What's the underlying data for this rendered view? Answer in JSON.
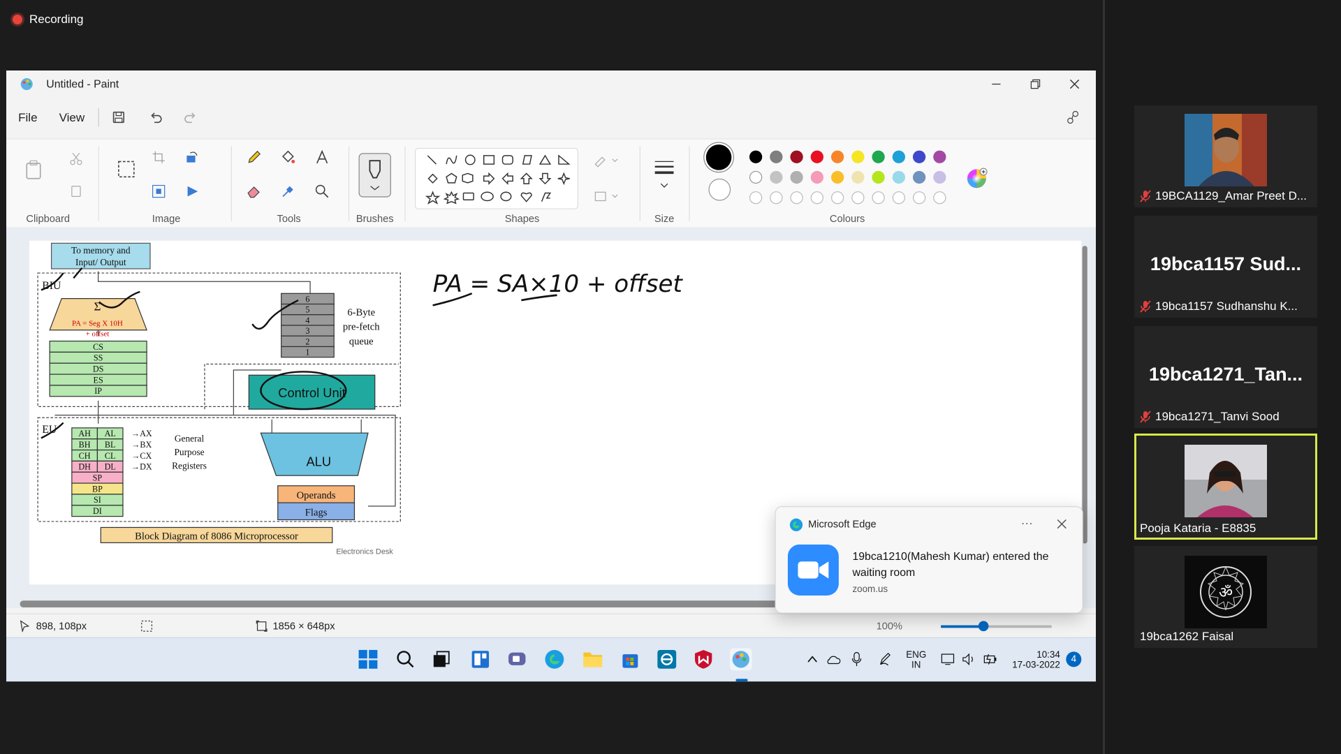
{
  "recording": {
    "label": "Recording"
  },
  "paint": {
    "title": "Untitled - Paint",
    "menu": {
      "file": "File",
      "view": "View"
    },
    "groups": {
      "clipboard": "Clipboard",
      "image": "Image",
      "tools": "Tools",
      "brushes": "Brushes",
      "shapes": "Shapes",
      "size": "Size",
      "colours": "Colours"
    },
    "palette_row1": [
      "#000000",
      "#7f7f7f",
      "#a01020",
      "#e81123",
      "#f7852a",
      "#f5e524",
      "#1fa84f",
      "#1ea0d8",
      "#3f48cc",
      "#a349a4"
    ],
    "palette_row2": [
      "#ffffff",
      "#c3c3c3",
      "#b0b0b0",
      "#f59bb7",
      "#f9be2a",
      "#efe4b0",
      "#b5e61d",
      "#99d9ea",
      "#7092be",
      "#c8bfe7"
    ],
    "status": {
      "cursor_pos": "898, 108px",
      "canvas_size": "1856 × 648px",
      "zoom": "100%"
    },
    "diagram": {
      "memory_box": "To memory and\nInput/ Output",
      "biu": "BIU",
      "eu": "EU",
      "sigma": "Σ",
      "pa_formula_1": "PA = Seg X 10H",
      "pa_formula_2": "+ offset",
      "segment_regs": [
        "CS",
        "SS",
        "DS",
        "ES",
        "IP"
      ],
      "queue_numbers": [
        "6",
        "5",
        "4",
        "3",
        "2",
        "1"
      ],
      "prefetch_label_1": "6-Byte",
      "prefetch_label_2": "pre-fetch",
      "prefetch_label_3": "queue",
      "control_unit": "Control Unit",
      "alu": "ALU",
      "operands": "Operands",
      "flags": "Flags",
      "gp_pairs": [
        [
          "AH",
          "AL"
        ],
        [
          "BH",
          "BL"
        ],
        [
          "CH",
          "CL"
        ],
        [
          "DH",
          "DL"
        ]
      ],
      "gp_arrows": [
        "→AX",
        "→BX",
        "→CX",
        "→DX"
      ],
      "gp_label_1": "General",
      "gp_label_2": "Purpose",
      "gp_label_3": "Registers",
      "pointer_regs": [
        "SP",
        "BP",
        "SI",
        "DI"
      ],
      "caption": "Block Diagram of 8086 Microprocessor",
      "watermark": "Electronics Desk",
      "handwriting": "PA = SA×10 + offset"
    },
    "toast": {
      "app": "Microsoft Edge",
      "message": "19bca1210(Mahesh Kumar) entered the waiting room",
      "source": "zoom.us"
    },
    "taskbar": {
      "lang_1": "ENG",
      "lang_2": "IN",
      "time": "10:34",
      "date": "17-03-2022",
      "notifications": "4"
    }
  },
  "participants": [
    {
      "display": "",
      "name": "19BCA1129_Amar Preet D...",
      "muted": true,
      "has_photo": true
    },
    {
      "display": "19bca1157 Sud...",
      "name": "19bca1157 Sudhanshu K...",
      "muted": true,
      "has_photo": false
    },
    {
      "display": "19bca1271_Tan...",
      "name": "19bca1271_Tanvi Sood",
      "muted": true,
      "has_photo": false
    },
    {
      "display": "",
      "name": "Pooja Kataria - E8835",
      "muted": false,
      "has_photo": true,
      "active": true
    },
    {
      "display": "",
      "name": "19bca1262 Faisal",
      "muted": false,
      "has_photo": true
    }
  ]
}
